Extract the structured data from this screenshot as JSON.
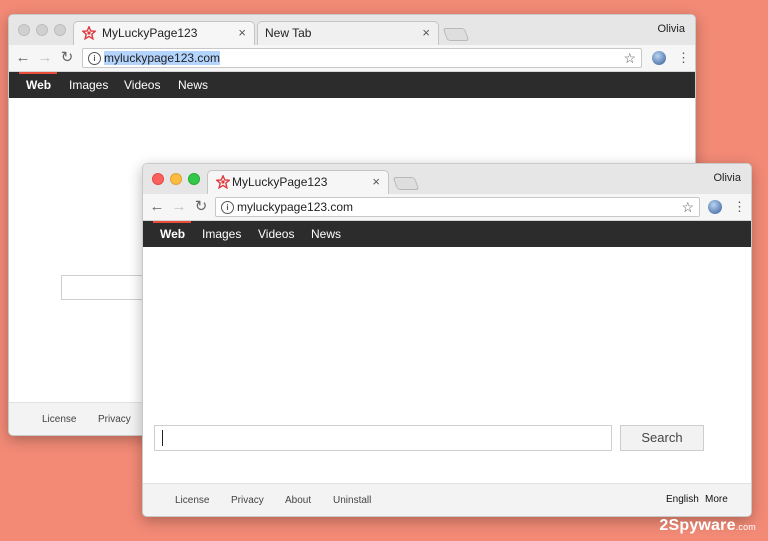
{
  "back_window": {
    "active_tab_title": "MyLuckyPage123",
    "second_tab_title": "New Tab",
    "tab_close_glyph": "×",
    "profile_name": "Olivia",
    "url": "myluckypage123.com",
    "nav_links": [
      "Web",
      "Images",
      "Videos",
      "News"
    ],
    "footer_links": [
      "License",
      "Privacy"
    ]
  },
  "front_window": {
    "active_tab_title": "MyLuckyPage123",
    "tab_close_glyph": "×",
    "profile_name": "Olivia",
    "url": "myluckypage123.com",
    "nav_links": [
      "Web",
      "Images",
      "Videos",
      "News"
    ],
    "search_button_label": "Search",
    "search_value": "",
    "footer_links": [
      "License",
      "Privacy",
      "About",
      "Uninstall"
    ],
    "footer_right": [
      "English",
      "More"
    ]
  },
  "watermark": {
    "brand": "2Spyware",
    "suffix": ".com"
  },
  "icons": {
    "back": "arrow-left",
    "forward": "arrow-right",
    "reload": "reload",
    "info": "info",
    "bookmark": "star",
    "extension": "globe",
    "menu": "vertical-dots"
  },
  "colors": {
    "background": "#f28a76",
    "navbar": "#2c2c2c",
    "active_underline": "#e84e3a",
    "selection": "#b3d4fc"
  }
}
